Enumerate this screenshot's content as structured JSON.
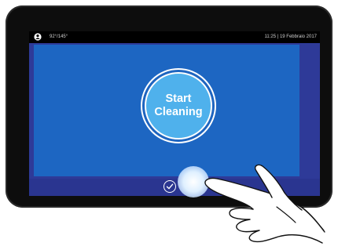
{
  "status_bar": {
    "temperature": "92°/145°",
    "clock": "11:25 | 19 Febbraio 2017"
  },
  "main": {
    "start_button": {
      "line1": "Start",
      "line2": "Cleaning"
    }
  },
  "icons": {
    "status": "person-circle-icon",
    "confirm": "check-icon"
  },
  "colors": {
    "bezel": "#0d0d0d",
    "screen_frame": "#2e3a98",
    "main_panel": "#1d66c2",
    "button_fill": "#4fb1ec",
    "status_bar": "#000000"
  }
}
